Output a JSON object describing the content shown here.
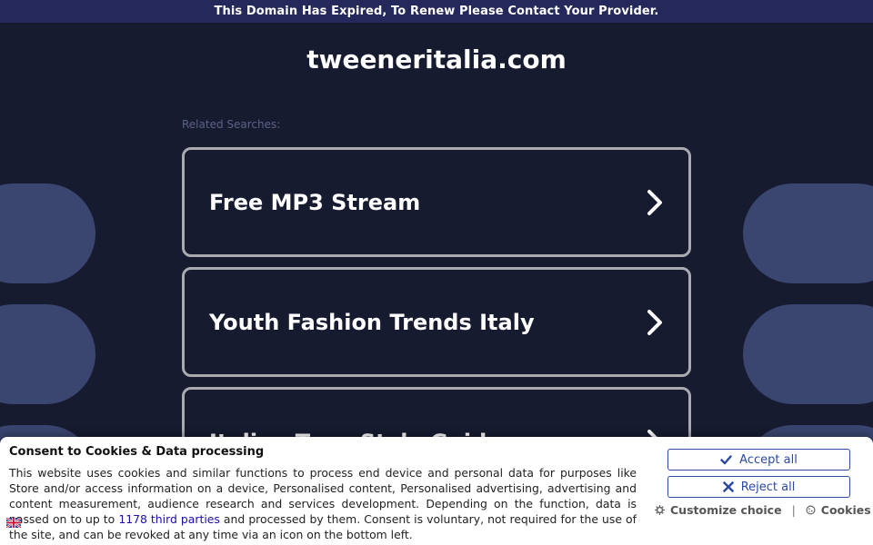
{
  "banner": {
    "text": "This Domain Has Expired, To Renew Please Contact Your Provider."
  },
  "site": {
    "domain": "tweeneritalia.com"
  },
  "related": {
    "label": "Related Searches:",
    "items": [
      {
        "label": "Free MP3 Stream"
      },
      {
        "label": "Youth Fashion Trends Italy"
      },
      {
        "label": "Italian Teen Style Guide"
      }
    ]
  },
  "consent": {
    "title": "Consent to Cookies & Data processing",
    "text_before_link": "This website uses cookies and similar functions to process end device and personal data for purposes like Store and/or access information on a device, Personalised content, Personalised advertising, advertising and content measurement, audience research and services development. Depending on the function, data is passed on to up to ",
    "link_text": "1178 third parties",
    "text_after_link": " and processed by them. Consent is voluntary, not required for the use of the site, and can be revoked at any time via an icon on the bottom left.",
    "accept_label": "Accept all",
    "reject_label": "Reject all",
    "customize_label": "Customize choice",
    "separator": "|",
    "cookies_label": "Cookies"
  },
  "colors": {
    "background": "#161b30",
    "banner": "#24285a",
    "card_border": "#a9aab0",
    "decor": "#3a4570",
    "button_accent": "#2c4aa0"
  },
  "icons": {
    "card_arrow": "chevron-right-icon",
    "accept": "check-icon",
    "reject": "x-icon",
    "customize": "gear-icon",
    "cookies": "cookie-icon",
    "language": "uk-flag-icon"
  }
}
